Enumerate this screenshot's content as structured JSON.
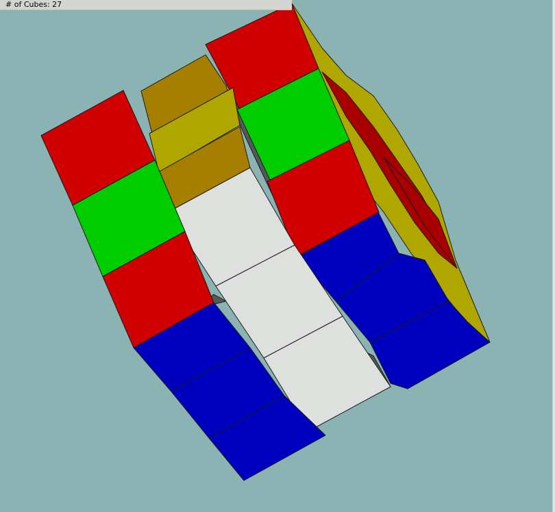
{
  "status": {
    "cube_count_label": "# of Cubes: 27"
  },
  "colors": {
    "background": "#8cb3b3",
    "red": "#d00000",
    "dark_red": "#a80000",
    "green": "#00cc00",
    "blue": "#0000bf",
    "yellow": "#b0a600",
    "mustard": "#a67f00",
    "white": "#dde0dc",
    "shadow": "#525a58"
  }
}
